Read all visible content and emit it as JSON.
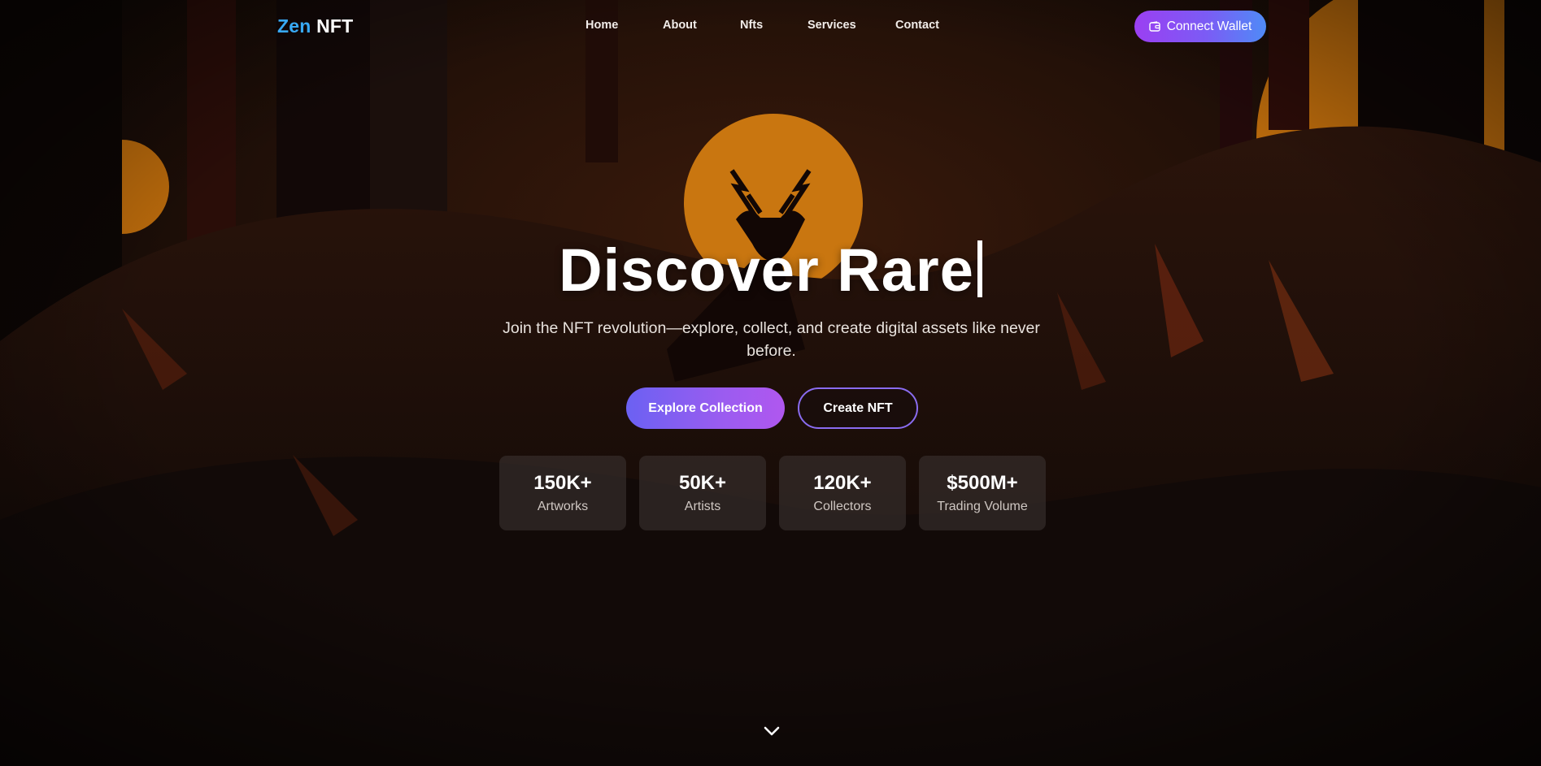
{
  "brand": {
    "first": "Zen",
    "second": "NFT",
    "first_color": "#38a9f5"
  },
  "nav": {
    "links": [
      "Home",
      "About",
      "Nfts",
      "Services",
      "Contact"
    ],
    "wallet_button": "Connect Wallet",
    "wallet_icon": "wallet-icon"
  },
  "hero": {
    "title": "Discover Rare",
    "subtitle": "Join the NFT revolution—explore, collect, and create digital assets like never before.",
    "primary_button": "Explore Collection",
    "secondary_button": "Create NFT"
  },
  "stats": [
    {
      "value": "150K+",
      "label": "Artworks"
    },
    {
      "value": "50K+",
      "label": "Artists"
    },
    {
      "value": "120K+",
      "label": "Collectors"
    },
    {
      "value": "$500M+",
      "label": "Trading Volume"
    }
  ],
  "scroll_icon": "chevron-down-icon",
  "colors": {
    "accent_gradient_start": "#9b3ff2",
    "accent_gradient_end": "#4f8bf6",
    "sun": "#e08a12",
    "background": "#0a0605"
  }
}
